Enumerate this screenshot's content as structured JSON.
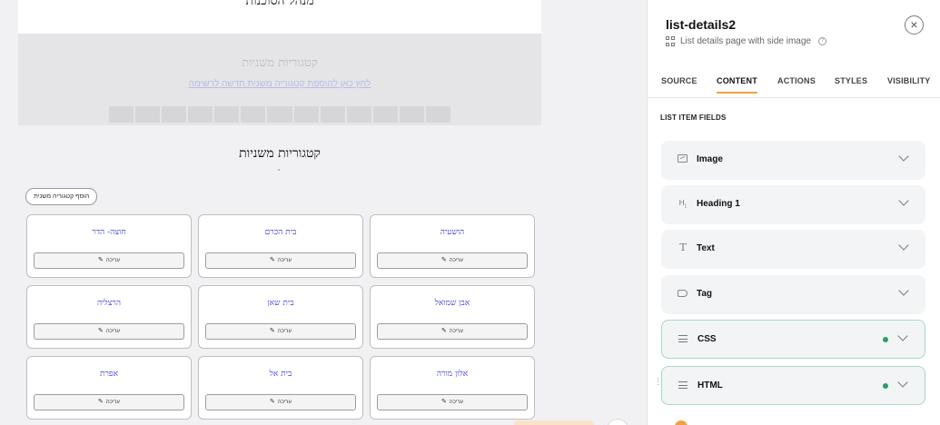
{
  "canvas": {
    "top_heading": "מנהל הסוכנות",
    "ghost_title": "קטגוריות משניות",
    "ghost_link": "לחץ כאן להוספת קטגוריה משנית חדשה לרשימה",
    "section_title": "קטגוריות משניות",
    "add_button_label": "הוסף קטגוריה משנית",
    "edit_label": "עריכה",
    "cards": [
      {
        "name": "הושעיה"
      },
      {
        "name": "בית הכרם"
      },
      {
        "name": "חוצה- הדר"
      },
      {
        "name": "אבן שמואל"
      },
      {
        "name": "בית שאן"
      },
      {
        "name": "הרצליה"
      },
      {
        "name": "אלון מורה"
      },
      {
        "name": "בית אל"
      },
      {
        "name": "אפרת"
      }
    ]
  },
  "panel": {
    "title": "list-details2",
    "subtitle": "List details page with side image",
    "tabs": [
      {
        "label": "SOURCE"
      },
      {
        "label": "CONTENT"
      },
      {
        "label": "ACTIONS"
      },
      {
        "label": "STYLES"
      },
      {
        "label": "VISIBILITY"
      }
    ],
    "active_tab": "CONTENT",
    "fields_label": "LIST ITEM FIELDS",
    "fields": [
      {
        "label": "Image",
        "icon": "image-icon"
      },
      {
        "label": "Heading 1",
        "icon": "heading-icon"
      },
      {
        "label": "Text",
        "icon": "text-icon"
      },
      {
        "label": "Tag",
        "icon": "tag-icon"
      },
      {
        "label": "CSS",
        "icon": "lines-icon",
        "status": "configured"
      },
      {
        "label": "HTML",
        "icon": "lines-icon",
        "status": "configured"
      }
    ],
    "colors": {
      "accent": "#f0a33a",
      "status_dot": "#2a9d6b",
      "card_link": "#3b3bd6"
    }
  }
}
